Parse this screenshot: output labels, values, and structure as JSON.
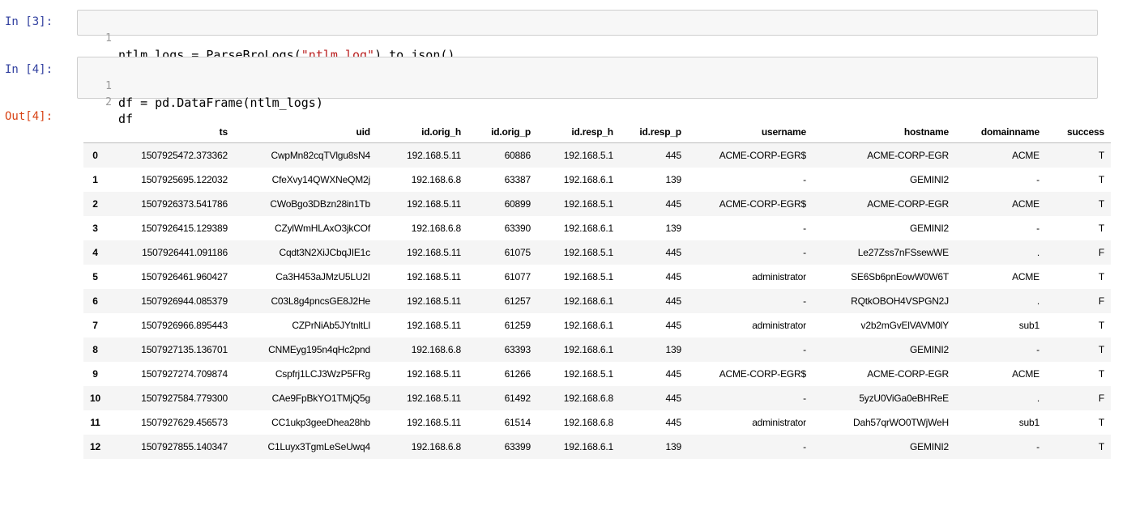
{
  "cells": [
    {
      "prompt": "In [3]:",
      "lines": [
        {
          "num": "1",
          "pre": "ntlm_logs = ParseBroLogs(",
          "str": "\"ntlm.log\"",
          "post": ").to_json()"
        }
      ]
    },
    {
      "prompt": "In [4]:",
      "lines": [
        {
          "num": "1",
          "pre": "df = pd.DataFrame(ntlm_logs)",
          "str": "",
          "post": ""
        },
        {
          "num": "2",
          "pre": "df",
          "str": "",
          "post": ""
        }
      ]
    }
  ],
  "output": {
    "prompt": "Out[4]:",
    "columns": [
      "ts",
      "uid",
      "id.orig_h",
      "id.orig_p",
      "id.resp_h",
      "id.resp_p",
      "username",
      "hostname",
      "domainname",
      "success"
    ],
    "rows": [
      {
        "index": "0",
        "cells": [
          "1507925472.373362",
          "CwpMn82cqTVlgu8sN4",
          "192.168.5.11",
          "60886",
          "192.168.5.1",
          "445",
          "ACME-CORP-EGR$",
          "ACME-CORP-EGR",
          "ACME",
          "T"
        ]
      },
      {
        "index": "1",
        "cells": [
          "1507925695.122032",
          "CfeXvy14QWXNeQM2j",
          "192.168.6.8",
          "63387",
          "192.168.6.1",
          "139",
          "-",
          "GEMINI2",
          "-",
          "T"
        ]
      },
      {
        "index": "2",
        "cells": [
          "1507926373.541786",
          "CWoBgo3DBzn28in1Tb",
          "192.168.5.11",
          "60899",
          "192.168.5.1",
          "445",
          "ACME-CORP-EGR$",
          "ACME-CORP-EGR",
          "ACME",
          "T"
        ]
      },
      {
        "index": "3",
        "cells": [
          "1507926415.129389",
          "CZylWmHLAxO3jkCOf",
          "192.168.6.8",
          "63390",
          "192.168.6.1",
          "139",
          "-",
          "GEMINI2",
          "-",
          "T"
        ]
      },
      {
        "index": "4",
        "cells": [
          "1507926441.091186",
          "Cqdt3N2XiJCbqJIE1c",
          "192.168.5.11",
          "61075",
          "192.168.5.1",
          "445",
          "-",
          "Le27Zss7nFSsewWE",
          ".",
          "F"
        ]
      },
      {
        "index": "5",
        "cells": [
          "1507926461.960427",
          "Ca3H453aJMzU5LU2I",
          "192.168.5.11",
          "61077",
          "192.168.5.1",
          "445",
          "administrator",
          "SE6Sb6pnEowW0W6T",
          "ACME",
          "T"
        ]
      },
      {
        "index": "6",
        "cells": [
          "1507926944.085379",
          "C03L8g4pncsGE8J2He",
          "192.168.5.11",
          "61257",
          "192.168.6.1",
          "445",
          "-",
          "RQtkOBOH4VSPGN2J",
          ".",
          "F"
        ]
      },
      {
        "index": "7",
        "cells": [
          "1507926966.895443",
          "CZPrNiAb5JYtnltLl",
          "192.168.5.11",
          "61259",
          "192.168.6.1",
          "445",
          "administrator",
          "v2b2mGvElVAVM0lY",
          "sub1",
          "T"
        ]
      },
      {
        "index": "8",
        "cells": [
          "1507927135.136701",
          "CNMEyg195n4qHc2pnd",
          "192.168.6.8",
          "63393",
          "192.168.6.1",
          "139",
          "-",
          "GEMINI2",
          "-",
          "T"
        ]
      },
      {
        "index": "9",
        "cells": [
          "1507927274.709874",
          "Cspfrj1LCJ3WzP5FRg",
          "192.168.5.11",
          "61266",
          "192.168.5.1",
          "445",
          "ACME-CORP-EGR$",
          "ACME-CORP-EGR",
          "ACME",
          "T"
        ]
      },
      {
        "index": "10",
        "cells": [
          "1507927584.779300",
          "CAe9FpBkYO1TMjQ5g",
          "192.168.5.11",
          "61492",
          "192.168.6.8",
          "445",
          "-",
          "5yzU0ViGa0eBHReE",
          ".",
          "F"
        ]
      },
      {
        "index": "11",
        "cells": [
          "1507927629.456573",
          "CC1ukp3geeDhea28hb",
          "192.168.5.11",
          "61514",
          "192.168.6.8",
          "445",
          "administrator",
          "Dah57qrWO0TWjWeH",
          "sub1",
          "T"
        ]
      },
      {
        "index": "12",
        "cells": [
          "1507927855.140347",
          "C1Luyx3TgmLeSeUwq4",
          "192.168.6.8",
          "63399",
          "192.168.6.1",
          "139",
          "-",
          "GEMINI2",
          "-",
          "T"
        ]
      }
    ]
  }
}
